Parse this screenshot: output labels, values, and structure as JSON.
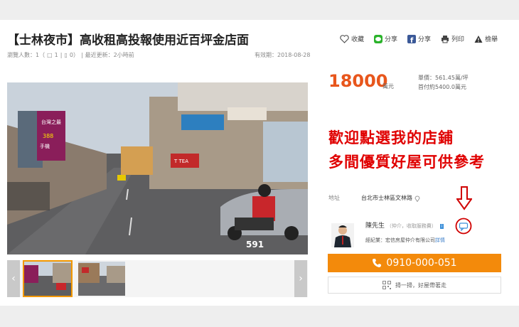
{
  "listing": {
    "title": "【士林夜市】高收租高投報使用近百坪金店面",
    "views_label": "瀏覽人數：1（",
    "comments_count": "1",
    "phone_count": "0）",
    "updated": "最近更新：2小時前",
    "expire": "有效期：2018-08-28"
  },
  "actions": {
    "favorite": "收藏",
    "line_share": "分享",
    "fb_share": "分享",
    "print": "列印",
    "report": "檢舉"
  },
  "price": {
    "amount": "18000",
    "unit": "萬元",
    "unit_price": "單價：561.45萬/坪",
    "down_payment": "首付約5400.0萬元"
  },
  "promo": {
    "line1": "歡迎點選我的店鋪",
    "line2": "多間優質好屋可供參考"
  },
  "address": {
    "label": "地址",
    "value": "台北市士林區文林路"
  },
  "agent": {
    "name": "陳先生",
    "role": "（仲介，收取服務費）",
    "badge": "i",
    "company_label": "經紀業：宏信房屋仲介有限公司",
    "company_link": "詳情"
  },
  "contact": {
    "phone": "0910-000-051",
    "qr_label": "掃一掃，好屋帶著走"
  },
  "photo": {
    "watermark": "591",
    "sign_text": "台灣之最",
    "sign_price": "388",
    "sign_sub": "手機",
    "tea_sign": "T TEA"
  },
  "colors": {
    "accent_orange": "#f38a0b",
    "price_orange": "#e8561c",
    "promo_red": "#e00000"
  }
}
